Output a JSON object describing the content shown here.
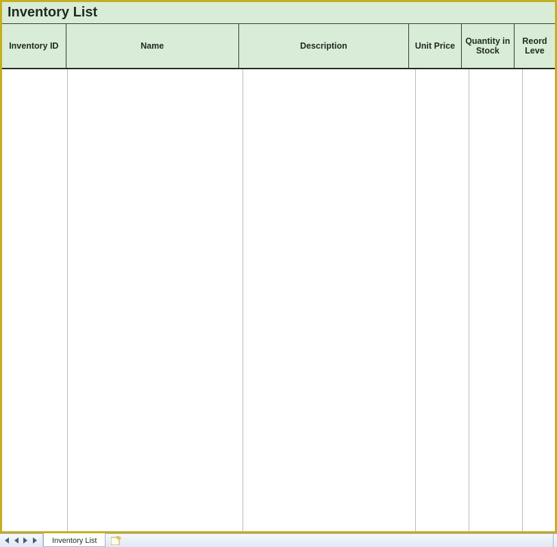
{
  "header": {
    "title": "Inventory List"
  },
  "columns": {
    "inventory_id": "Inventory ID",
    "name": "Name",
    "description": "Description",
    "unit_price": "Unit Price",
    "quantity_in_stock": "Quantity in Stock",
    "reorder_level": "Reord Leve"
  },
  "rows": [],
  "tabs": {
    "active": "Inventory List"
  }
}
